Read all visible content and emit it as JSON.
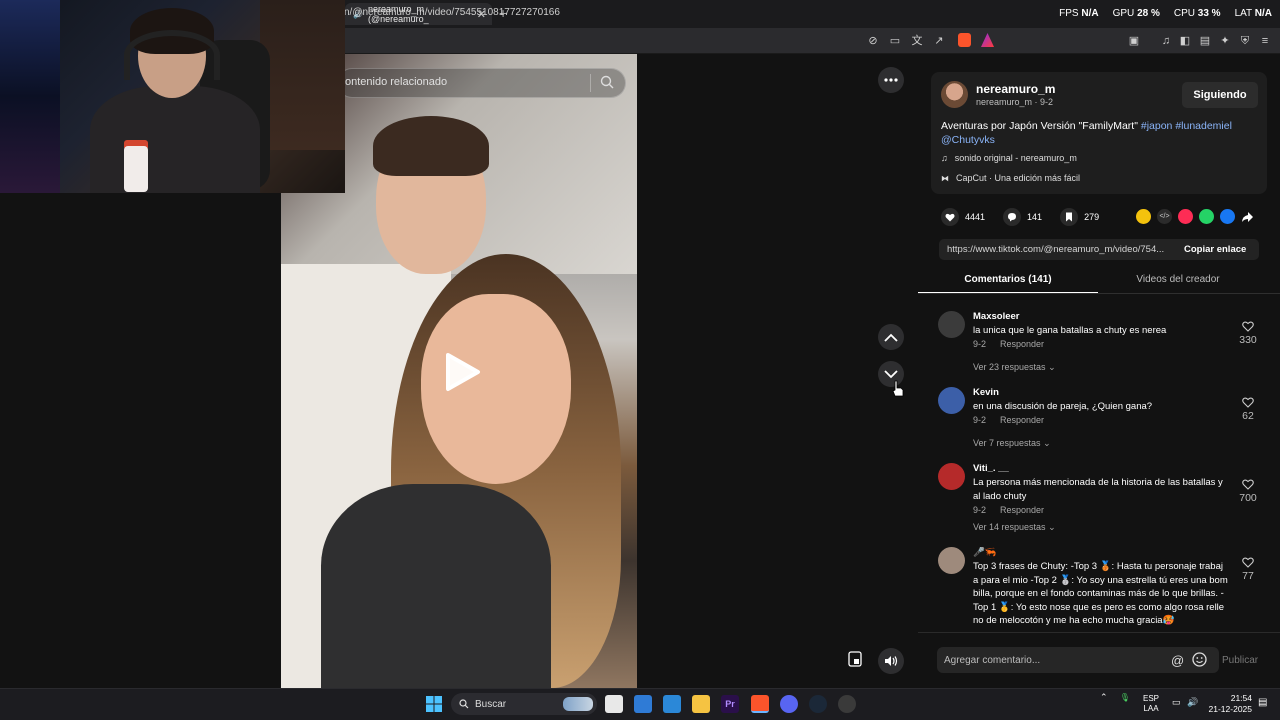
{
  "browser": {
    "tab_title": "nereamuro_m (@nereamuro_",
    "tab_close": "✕",
    "new_tab": "+",
    "url": "n/@nereamuro_m/video/7545510817727270166"
  },
  "stats_overlay": {
    "fps_label": "FPS",
    "fps_value": "N/A",
    "gpu_label": "GPU",
    "gpu_value": "28 %",
    "cpu_label": "CPU",
    "cpu_value": "33 %",
    "lat_label": "LAT",
    "lat_value": "N/A"
  },
  "player": {
    "search_placeholder": "ontenido relacionado"
  },
  "creator": {
    "name": "nereamuro_m",
    "subline": "nereamuro_m · 9-2",
    "follow_label": "Siguiendo",
    "description_text": "Aventuras por Japón Versión \"FamilyMart\"",
    "tag1": "#japon",
    "tag2": "#lunademiel",
    "mention": "@Chutyvks",
    "sound": "sonido original - nereamuro_m",
    "capcut": "CapCut · Una edición más fácil"
  },
  "actions": {
    "likes": "4441",
    "comments": "141",
    "saves": "279"
  },
  "share": {
    "link": "https://www.tiktok.com/@nereamuro_m/video/754...",
    "copy_label": "Copiar enlace"
  },
  "tabs": {
    "comments": "Comentarios (141)",
    "creator_videos": "Videos del creador"
  },
  "comments": [
    {
      "user": "Maxsoleer",
      "text": "la unica que le gana batallas a chuty es nerea",
      "date": "9-2",
      "reply": "Responder",
      "replies": "Ver 23 respuestas",
      "likes": "330",
      "avatar_color": "#3b3b3b"
    },
    {
      "user": "Kevin",
      "text": "en una discusión de pareja, ¿Quien gana?",
      "date": "9-2",
      "reply": "Responder",
      "replies": "Ver 7 respuestas",
      "likes": "62",
      "avatar_color": "#3c5fa8"
    },
    {
      "user": "Viti_. __",
      "text": "La persona más mencionada de la historia de las batallas y al lado chuty",
      "date": "9-2",
      "reply": "Responder",
      "replies": "Ver 14 respuestas",
      "likes": "700",
      "avatar_color": "#b52a2a"
    },
    {
      "user": "🎤🦐",
      "text": "Top 3 frases de Chuty: -Top 3 🥉: Hasta tu personaje trabaj a para el mio -Top 2 🥈: Yo soy una estrella tú eres una bom billa, porque en el fondo contaminas más de lo que brillas. - Top 1 🥇: Yo esto nose que es pero es como algo rosa relle no de melocotón y me ha echo mucha gracia🥵",
      "likes": "77",
      "avatar_color": "#9e8a7c"
    }
  ],
  "composer": {
    "placeholder": "Agregar comentario...",
    "at": "@",
    "publish": "Publicar"
  },
  "taskbar": {
    "search": "Buscar",
    "lang_line1": "ESP",
    "lang_line2": "LAA",
    "time": "21:54",
    "date": "21-12-2025"
  },
  "colors": {
    "accent_tag": "#8ab4f8",
    "panel_bg": "#121212",
    "card_bg": "#1e1e1e"
  }
}
